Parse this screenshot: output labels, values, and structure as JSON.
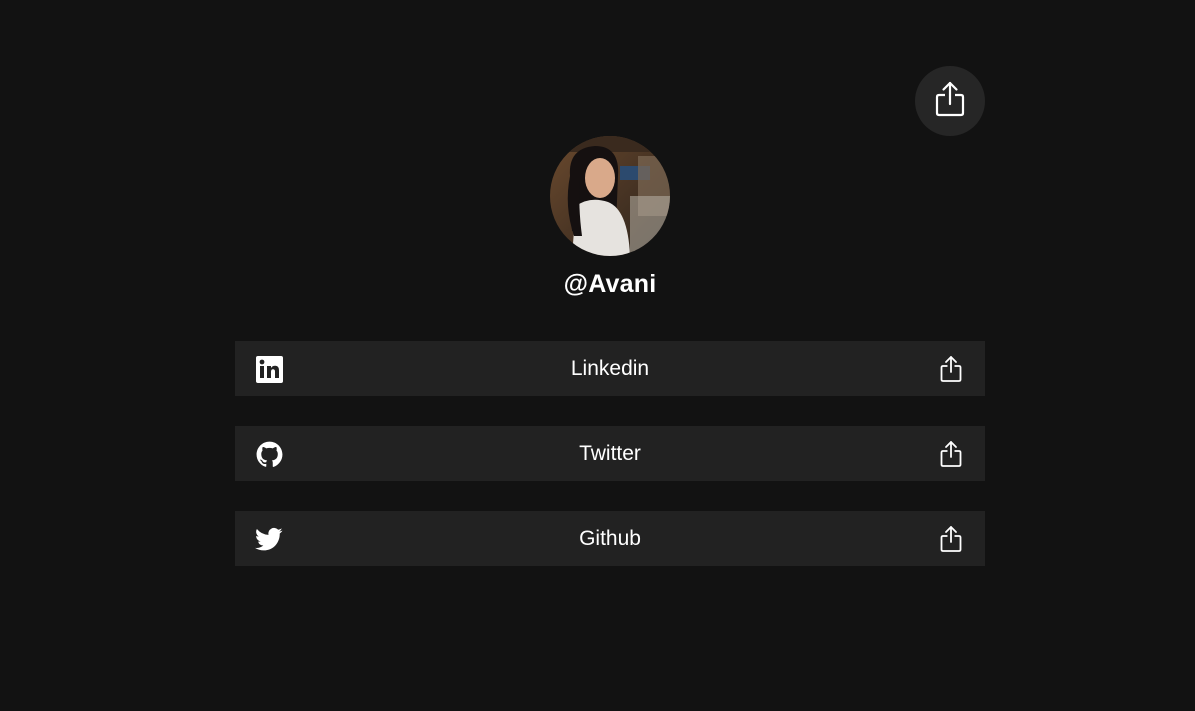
{
  "profile": {
    "username": "@Avani"
  },
  "links": [
    {
      "label": "Linkedin",
      "icon": "linkedin-icon"
    },
    {
      "label": "Twitter",
      "icon": "github-icon"
    },
    {
      "label": "Github",
      "icon": "twitter-icon"
    }
  ],
  "colors": {
    "background": "#121212",
    "card": "#222222",
    "share_button": "#262626",
    "text": "#ffffff"
  }
}
